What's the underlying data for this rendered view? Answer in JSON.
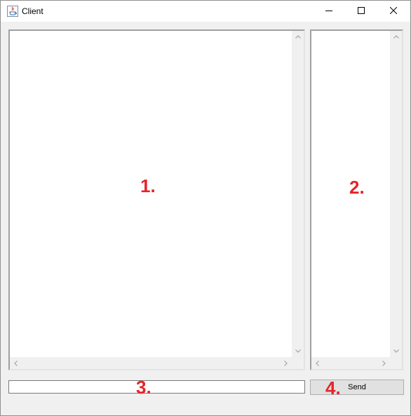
{
  "window": {
    "title": "Client"
  },
  "titlebar": {
    "icons": [
      "java-app-icon",
      "minimize-icon",
      "maximize-icon",
      "close-icon"
    ]
  },
  "overlay_labels": {
    "one": "1.",
    "two": "2.",
    "three": "3.",
    "four": "4."
  },
  "message_input": {
    "value": "",
    "placeholder": ""
  },
  "send_button": {
    "label": "Send"
  },
  "colors": {
    "overlay_label": "#e5252a",
    "window_bg": "#f0f0f0",
    "panel_bg": "#ffffff"
  }
}
